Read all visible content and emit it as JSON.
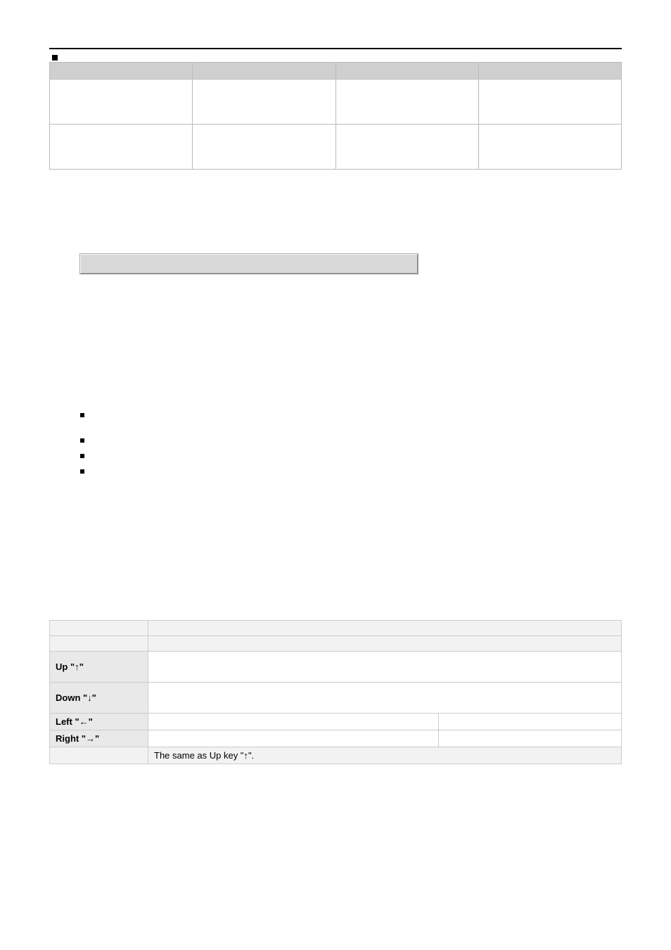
{
  "keys": {
    "up": "Up \"↑\"",
    "down": "Down \"↓\"",
    "left": "Left \"←\"",
    "right": "Right \"→\"",
    "same_as_up": "The same as Up key \"↑\"."
  }
}
